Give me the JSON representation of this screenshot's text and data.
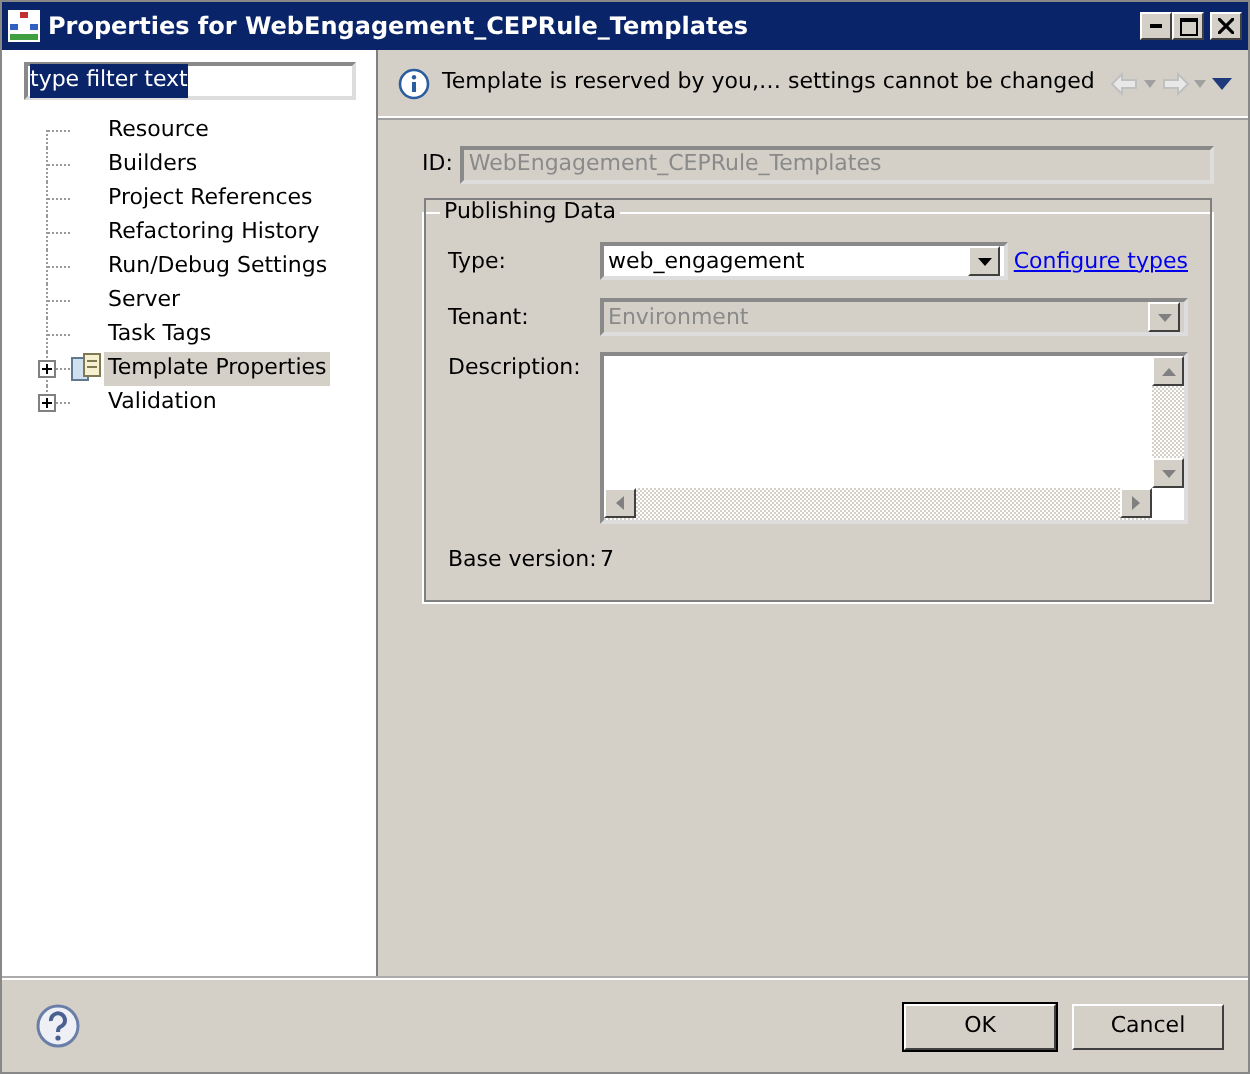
{
  "window": {
    "title": "Properties for WebEngagement_CEPRule_Templates"
  },
  "filter": {
    "value": "type filter text",
    "highlighted": true
  },
  "tree": [
    {
      "label": "Resource",
      "kind": "page",
      "selected": false
    },
    {
      "label": "Builders",
      "kind": "page",
      "selected": false
    },
    {
      "label": "Project References",
      "kind": "page",
      "selected": false
    },
    {
      "label": "Refactoring History",
      "kind": "page",
      "selected": false
    },
    {
      "label": "Run/Debug Settings",
      "kind": "page",
      "selected": false
    },
    {
      "label": "Server",
      "kind": "page",
      "selected": false
    },
    {
      "label": "Task Tags",
      "kind": "page",
      "selected": false
    },
    {
      "label": "Template Properties",
      "kind": "category_with_icon",
      "expanded": false,
      "selected": true
    },
    {
      "label": "Validation",
      "kind": "category",
      "expanded": false,
      "selected": false
    }
  ],
  "message": "Template is reserved by you,… settings cannot be changed",
  "id_field": {
    "label": "ID:",
    "value": "WebEngagement_CEPRule_Templates",
    "disabled": true
  },
  "group": {
    "title": "Publishing Data",
    "type": {
      "label": "Type:",
      "value": "web_engagement",
      "disabled": false
    },
    "configure_link": "Configure types",
    "tenant": {
      "label": "Tenant:",
      "value": "Environment",
      "disabled": true
    },
    "description": {
      "label": "Description:"
    },
    "base_version": {
      "label": "Base version:",
      "value": "7"
    }
  },
  "buttons": [
    {
      "label": "OK",
      "default": true
    },
    {
      "label": "Cancel",
      "default": false
    }
  ]
}
